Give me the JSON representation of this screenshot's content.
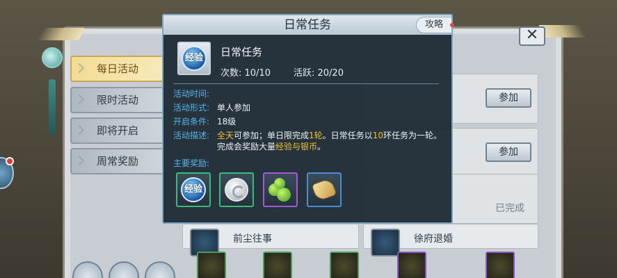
{
  "popup": {
    "title": "日常任务",
    "guide_label": "攻略",
    "task": {
      "icon_label": "经验",
      "name": "日常任务",
      "count_text": "次数: 10/10",
      "active_text": "活跃: 20/20"
    },
    "info": {
      "time_label": "活动时间:",
      "time_value": "",
      "form_label": "活动形式:",
      "form_value": "单人参加",
      "condition_label": "开启条件:",
      "condition_value": "18级",
      "desc_label": "活动描述:",
      "desc": {
        "p1": "全天",
        "p2": "可参加；单日限完成",
        "p3": "1轮",
        "p4": "。日常任务以",
        "p5": "10",
        "p6": "环任务为一轮。",
        "p7": "完成会奖励大量",
        "p8": "经验与银币",
        "p9": "。"
      }
    },
    "rewards_label": "主要奖励:",
    "rewards": [
      {
        "icon": "exp-orb-icon",
        "label": "经验"
      },
      {
        "icon": "silver-coin-icon"
      },
      {
        "icon": "green-fruit-icon"
      },
      {
        "icon": "golden-scroll-icon"
      }
    ]
  },
  "sidebar": {
    "items": [
      {
        "label": "每日活动",
        "active": true
      },
      {
        "label": "限时活动"
      },
      {
        "label": "即将开启"
      },
      {
        "label": "周常奖励"
      }
    ]
  },
  "list": {
    "join_label": "参加",
    "done_label": "已完成",
    "bottom_cards": [
      "前尘往事",
      "徐府退婚"
    ]
  },
  "colors": {
    "accent_blue": "#58b6ea",
    "highlight_gold": "#f2c232",
    "popup_bg": "#1e2a34"
  }
}
